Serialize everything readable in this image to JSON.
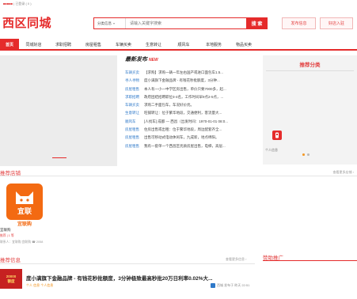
{
  "topbar": {
    "highlight": "■■■■■",
    "text": "| 已登录 ( 0 )"
  },
  "header": {
    "logo": "西区同城",
    "search": {
      "category": "分类信息",
      "placeholder": "请输入关键字搜索",
      "button": "搜 索"
    },
    "post_button": "发布信息",
    "shop_button": "好店入驻"
  },
  "nav": {
    "items": [
      {
        "label": "首页",
        "active": true
      },
      {
        "label": "同城好店"
      },
      {
        "label": "求职招聘"
      },
      {
        "label": "房屋租售"
      },
      {
        "label": "车辆买卖"
      },
      {
        "label": "生意转让"
      },
      {
        "label": "顺风车"
      },
      {
        "label": "本地服务"
      },
      {
        "label": "物品买卖"
      }
    ]
  },
  "news": {
    "title": "最新发布",
    "new_tag": "NEW",
    "rows": [
      {
        "cat": "车辆买卖",
        "text": "【求购】求购一辆一年左右国产或进口面包车1.5..."
      },
      {
        "cat": "寻人寻物",
        "text": "度小满旗下金融品牌 - 有钱花秒批额度，3分钟..."
      },
      {
        "cat": "房屋租售",
        "text": "本人有一小一中学区房出售，单价只要7000多，起..."
      },
      {
        "cat": "求职招聘",
        "text": "政府团结招聘职位3-4名，工作时间早9点2-5点，..."
      },
      {
        "cat": "车辆买卖",
        "text": "求购二手面包车，车况好价优。"
      },
      {
        "cat": "生意转让",
        "text": "旺铺转让：位于繁华地段，交通便利，客流量大..."
      },
      {
        "cat": "顺风车",
        "text": "[人找车] 成都 — 西昌（出发时间：1970-01-01 08:0..."
      },
      {
        "cat": "房屋租售",
        "text": "住房出售或出租：位于繁华地段，周边配套齐全..."
      },
      {
        "cat": "房屋租售",
        "text": "出售可移动式电动休闲车，九成新，地点绵阳。"
      },
      {
        "cat": "房屋租售",
        "text": "我有一套单一个西昌区优质房屋出售，电梯，高层..."
      }
    ]
  },
  "recommend": {
    "title": "推荐分类",
    "item_label": "个人信息"
  },
  "shops_section": {
    "title": "推荐店铺",
    "more": "查看更多店铺 ›"
  },
  "shop": {
    "app_name": "宜联",
    "brand": "宜联购",
    "name": "宜联购",
    "sub": "推荐 | 1 等",
    "sub2": "联系人：宜联购 宜联购 ☎ 2058"
  },
  "info_section": {
    "title": "推荐信息",
    "more": "查看更多信息 ›"
  },
  "ad_section": {
    "title": "赞助推广"
  },
  "post": {
    "thumb": "20000\n额度",
    "title": "度小满旗下金融品牌 - 有钱花秒批额度，3分钟极致最高秒批20万日利率0.02%大...",
    "tags": "个人 信息 个人信息",
    "meta": "西城 发布于 昨天 22:51"
  },
  "colors": {
    "accent": "#e52b2b",
    "link": "#2f79c9",
    "brand_orange": "#f36a12"
  }
}
